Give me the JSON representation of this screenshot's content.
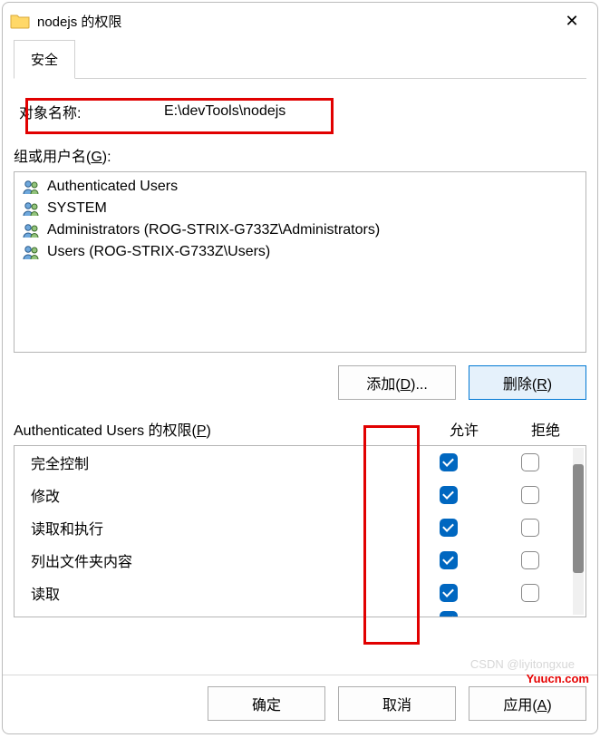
{
  "window": {
    "title": "nodejs 的权限"
  },
  "tab": "安全",
  "obj": {
    "label": "对象名称:",
    "value": "E:\\devTools\\nodejs"
  },
  "groups": {
    "label_pre": "组或用户名(",
    "label_u": "G",
    "label_post": "):",
    "items": [
      "Authenticated Users",
      "SYSTEM",
      "Administrators (ROG-STRIX-G733Z\\Administrators)",
      "Users (ROG-STRIX-G733Z\\Users)"
    ]
  },
  "btn": {
    "add_pre": "添加(",
    "add_u": "D",
    "add_post": ")...",
    "del_pre": "删除(",
    "del_u": "R",
    "del_post": ")",
    "ok": "确定",
    "cancel": "取消",
    "apply_pre": "应用(",
    "apply_u": "A",
    "apply_post": ")"
  },
  "perm": {
    "label_pre": "Authenticated Users 的权限(",
    "label_u": "P",
    "label_post": ")",
    "col_allow": "允许",
    "col_deny": "拒绝",
    "rows": [
      {
        "name": "完全控制",
        "allow": true,
        "deny": false
      },
      {
        "name": "修改",
        "allow": true,
        "deny": false
      },
      {
        "name": "读取和执行",
        "allow": true,
        "deny": false
      },
      {
        "name": "列出文件夹内容",
        "allow": true,
        "deny": false
      },
      {
        "name": "读取",
        "allow": true,
        "deny": false
      }
    ]
  },
  "wm": {
    "csdn": "CSDN @liyitongxue",
    "yuucn": "Yuucn.com"
  }
}
